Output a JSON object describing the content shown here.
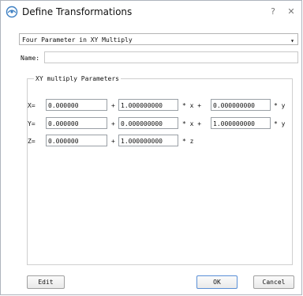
{
  "window": {
    "title": "Define Transformations",
    "help_glyph": "?",
    "close_glyph": "✕"
  },
  "combo": {
    "value": "Four Parameter in XY Multiply",
    "arrow": "▾"
  },
  "name": {
    "label": "Name:",
    "value": ""
  },
  "group": {
    "title": "XY multiply Parameters"
  },
  "rows": [
    {
      "label": "X=",
      "a": "0.000000",
      "op1": "+",
      "b": "1.000000000",
      "op2": "* x +",
      "c": "0.000000000",
      "op3": "* y"
    },
    {
      "label": "Y=",
      "a": "0.000000",
      "op1": "+",
      "b": "0.000000000",
      "op2": "* x +",
      "c": "1.000000000",
      "op3": "* y"
    },
    {
      "label": "Z=",
      "a": "0.000000",
      "op1": "+",
      "b": "1.000000000",
      "op2": "* z"
    }
  ],
  "buttons": {
    "edit": "Edit",
    "ok": "OK",
    "cancel": "Cancel"
  }
}
